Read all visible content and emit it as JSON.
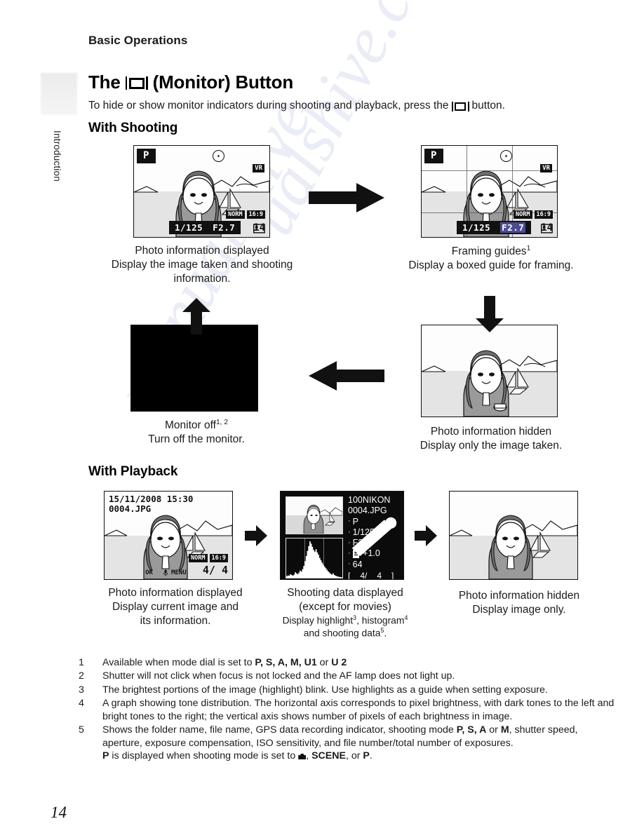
{
  "page": {
    "running_head": "Basic Operations",
    "tab_label": "Introduction",
    "folio": "14"
  },
  "heading": {
    "title_before": "The",
    "title_after": "(Monitor) Button",
    "monitor_icon": "monitor-button-icon",
    "intro_before": "To hide or show monitor indicators during shooting and playback, press the",
    "intro_after": "button."
  },
  "sections": {
    "shooting": "With Shooting",
    "playback": "With Playback"
  },
  "screens": {
    "shoot_info": {
      "mode": "P",
      "flash": "flash-off-icon",
      "vr": "VR",
      "quality": "NORM",
      "image_size": "16:9",
      "shutter": "1/125",
      "aperture": "F2.7",
      "shots_remaining": "14",
      "card_icon": "memory-card-icon"
    },
    "shoot_guides": {
      "mode": "P",
      "flash": "flash-off-icon",
      "vr": "VR",
      "quality": "NORM",
      "image_size": "16:9",
      "shutter": "1/125",
      "aperture": "F2.7",
      "shots_remaining": "14",
      "grid": "framing-guide-grid"
    },
    "monitor_off": {
      "label": "monitor-off-black-screen"
    },
    "playback_info": {
      "date": "15/11/2008 15:30",
      "filename": "0004.JPG",
      "quality": "NORM",
      "image_size": "16:9",
      "frame_current": "4/",
      "frame_total": "4",
      "ok_label": "OK",
      "mic_icon": "microphone-icon",
      "menu_label": "MENU"
    },
    "playback_data": {
      "folder": "100NIKON",
      "filename": "0004.JPG",
      "gps_icon": "gps-indicator-icon",
      "mode": "P",
      "shutter": "1/125",
      "aperture": "F2.7",
      "exposure_comp_icon": "exposure-compensation-icon",
      "exposure_comp": "+1.0",
      "iso": "64",
      "frame_current": "4/",
      "frame_total": "4",
      "histogram": [
        4,
        6,
        5,
        9,
        7,
        5,
        8,
        14,
        11,
        9,
        13,
        18,
        16,
        22,
        30,
        42,
        55,
        68,
        80,
        92,
        86,
        78,
        70,
        66,
        72,
        64,
        58,
        50,
        44,
        38,
        33,
        28,
        24,
        20,
        16,
        13,
        10,
        8,
        11,
        7,
        5,
        4,
        3,
        2,
        2,
        1
      ]
    }
  },
  "captions": {
    "shoot_info": {
      "title": "Photo information displayed",
      "line2": "Display the image taken and shooting",
      "line3": "information."
    },
    "shoot_guides": {
      "title": "Framing guides",
      "title_sup": "1",
      "line2": "Display a boxed guide for framing."
    },
    "monitor_off": {
      "title": "Monitor off",
      "title_sup": "1, 2",
      "line2": "Turn off the monitor."
    },
    "shoot_hidden": {
      "title": "Photo information hidden",
      "line2": "Display only the image taken."
    },
    "play_info": {
      "title": "Photo information displayed",
      "line2": "Display current image and",
      "line3": "its information."
    },
    "play_data": {
      "title": "Shooting data displayed",
      "line2": "(except for movies)",
      "line3_a": "Display highlight",
      "line3_sup_a": "3",
      "line3_b": ", histogram",
      "line3_sup_b": "4",
      "line4_a": "and shooting data",
      "line4_sup": "5",
      "line4_b": "."
    },
    "play_hidden": {
      "title": "Photo information hidden",
      "line2": "Display image only."
    }
  },
  "footnotes": [
    {
      "num": "1",
      "text_a": "Available when mode dial is set to ",
      "modes": "P, S, A, M, U1",
      "text_b": " or ",
      "modes_b": "U 2"
    },
    {
      "num": "2",
      "text_a": "Shutter will not click when focus is not locked and the AF lamp does not light up."
    },
    {
      "num": "3",
      "text_a": "The brightest portions of the image (highlight) blink. Use highlights as a guide when setting exposure."
    },
    {
      "num": "4",
      "text_a": "A graph showing tone distribution. The horizontal axis corresponds to pixel brightness, with dark tones to the left and bright tones to the right; the vertical axis shows number of pixels of each brightness in image."
    },
    {
      "num": "5",
      "text_a": "Shows the folder name, file name, GPS data recording indicator, shooting mode ",
      "modes": "P, S, A",
      "text_b": " or ",
      "modes_b": "M",
      "text_c": ", shutter speed, aperture, exposure compensation, ISO sensitivity, and file number/total number of exposures.",
      "sub_a": "P",
      "sub_b": " is displayed when shooting mode is set to ",
      "sub_icon": "camera-auto-icon",
      "sub_c": ", ",
      "sub_scene": "SCENE",
      "sub_d": ", or ",
      "sub_e": "P",
      "sub_f": "."
    }
  ],
  "watermark": {
    "line1": "ualshive.com",
    "line2": "manualshive"
  }
}
